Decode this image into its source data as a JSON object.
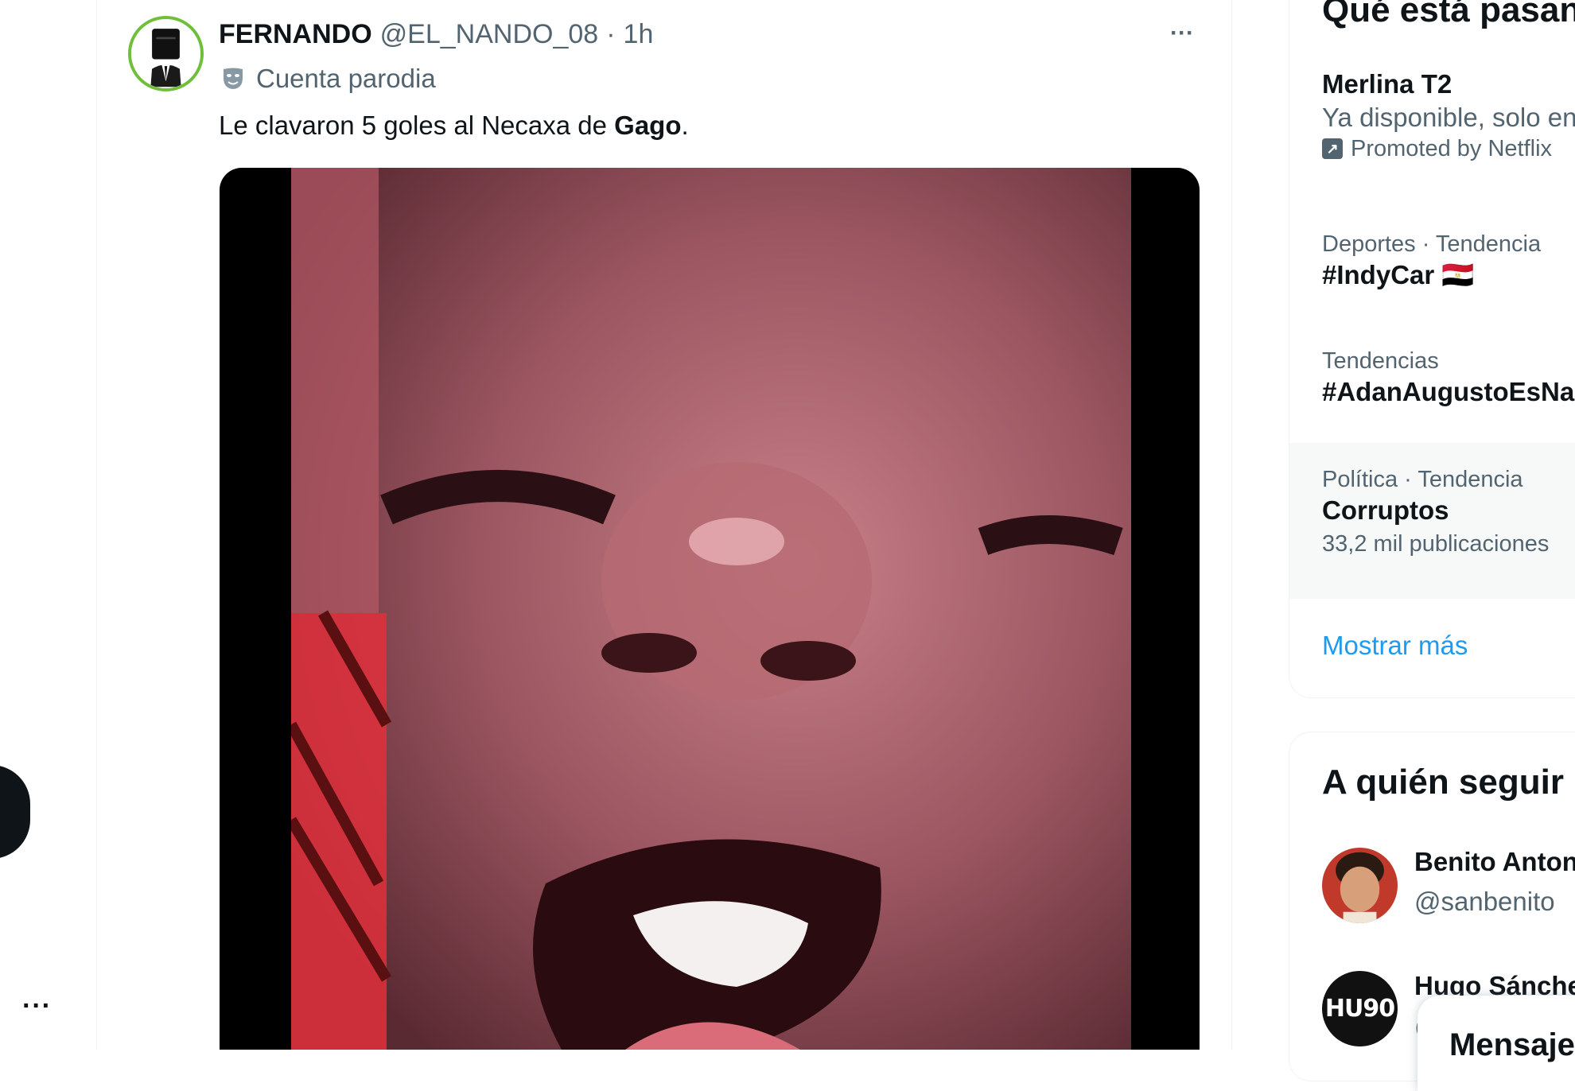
{
  "left_nav": {
    "more_label": "···"
  },
  "tweet": {
    "display_name": "FERNANDO",
    "handle": "@EL_NANDO_08",
    "separator": "·",
    "time": "1h",
    "more_label": "···",
    "parody_label": "Cuenta parodia",
    "text_prefix": "Le clavaron 5 goles al Necaxa de ",
    "text_bold": "Gago",
    "text_suffix": ".",
    "avatar_ring_color": "#6fbf3a"
  },
  "trends": {
    "title": "Qué está pasando",
    "items": [
      {
        "name": "Merlina T2",
        "subtitle": "Ya disponible, solo en Netflix",
        "promo": "Promoted by Netflix"
      },
      {
        "meta": "Deportes · Tendencia",
        "name": "#IndyCar 🇪🇬"
      },
      {
        "meta": "Tendencias",
        "name": "#AdanAugustoEsNarco"
      },
      {
        "meta": "Política · Tendencia",
        "name": "Corruptos",
        "count": "33,2 mil publicaciones"
      }
    ],
    "show_more": "Mostrar más"
  },
  "who_to_follow": {
    "title": "A quién seguir",
    "users": [
      {
        "name": "Benito Antonio",
        "handle": "@sanbenito"
      },
      {
        "name": "Hugo Sánchez",
        "handle": "@"
      }
    ],
    "hugo_logo_text": "HU90"
  },
  "messages": {
    "title": "Mensajes"
  },
  "colors": {
    "accent": "#1d9bf0",
    "secondary_text": "#536471",
    "primary_text": "#0f1419",
    "border": "#eff3f4"
  }
}
